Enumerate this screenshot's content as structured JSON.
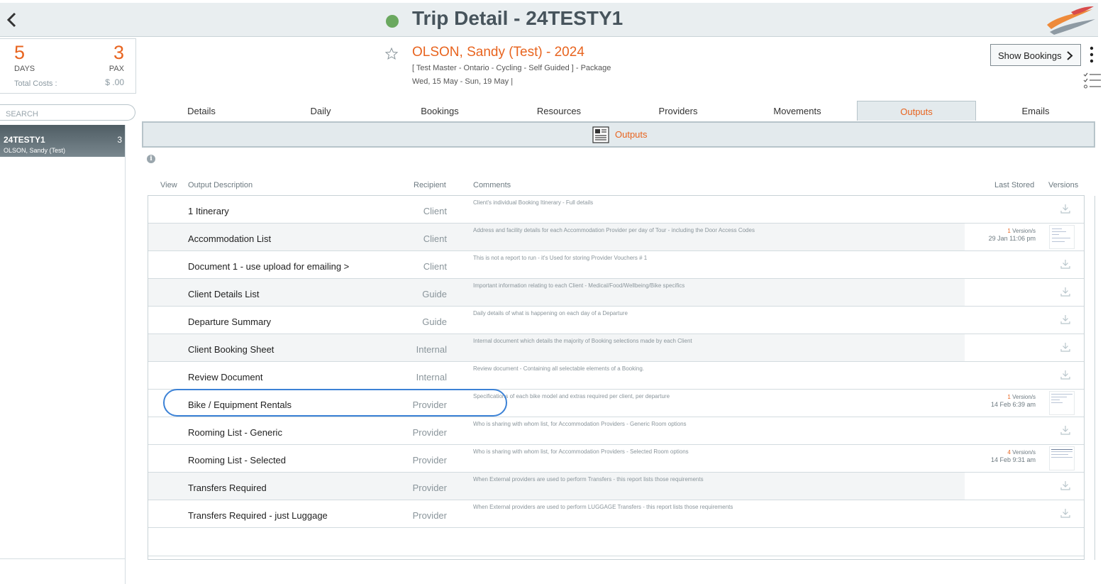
{
  "header": {
    "title": "Trip Detail - 24TESTY1",
    "status_color": "#6aa85f"
  },
  "summary": {
    "days_value": "5",
    "days_label": "DAYS",
    "pax_value": "3",
    "pax_label": "PAX",
    "total_costs_label": "Total Costs :",
    "total_costs_value": "$ .00"
  },
  "search": {
    "placeholder": "SEARCH"
  },
  "trip_list": [
    {
      "code": "24TESTY1",
      "count": "3",
      "name": "OLSON, Sandy (Test)"
    }
  ],
  "booking": {
    "title": "OLSON, Sandy (Test) - 2024",
    "subtitle": "[ Test Master - Ontario - Cycling - Self Guided ] - Package",
    "dates": "Wed, 15 May  - Sun, 19 May  |"
  },
  "actions": {
    "show_bookings": "Show Bookings"
  },
  "tabs": [
    "Details",
    "Daily",
    "Bookings",
    "Resources",
    "Providers",
    "Movements",
    "Outputs",
    "Emails"
  ],
  "active_tab": "Outputs",
  "subbar": {
    "label": "Outputs"
  },
  "table": {
    "headers": {
      "view": "View",
      "description": "Output Description",
      "recipient": "Recipient",
      "comments": "Comments",
      "last_stored": "Last Stored",
      "versions": "Versions"
    },
    "rows": [
      {
        "description": "1 Itinerary",
        "recipient": "Client",
        "comment": "Client's individual Booking Itinerary - Full details",
        "versions": "",
        "version_label": "",
        "stored": ""
      },
      {
        "description": "Accommodation List",
        "recipient": "Client",
        "comment": "Address and facility details for each Accommodation Provider per day of Tour - including the Door Access Codes",
        "versions": "1",
        "version_label": "Version/s",
        "stored": "29 Jan 11:06 pm"
      },
      {
        "description": "Document 1 - use upload for emailing >",
        "recipient": "Client",
        "comment": "This is not a report to run - it's Used for storing Provider Vouchers # 1",
        "versions": "",
        "version_label": "",
        "stored": ""
      },
      {
        "description": "Client Details List",
        "recipient": "Guide",
        "comment": "Important information relating to each Client - Medical/Food/Wellbeing/Bike specifics",
        "versions": "",
        "version_label": "",
        "stored": ""
      },
      {
        "description": "Departure Summary",
        "recipient": "Guide",
        "comment": "Daily details of what is happening on each day of a Departure",
        "versions": "",
        "version_label": "",
        "stored": ""
      },
      {
        "description": "Client Booking Sheet",
        "recipient": "Internal",
        "comment": "Internal document which details the majority of Booking selections made by each Client",
        "versions": "",
        "version_label": "",
        "stored": ""
      },
      {
        "description": "Review Document",
        "recipient": "Internal",
        "comment": "Review document  - Containing all selectable elements of a Booking.",
        "versions": "",
        "version_label": "",
        "stored": ""
      },
      {
        "description": "Bike  / Equipment Rentals",
        "recipient": "Provider",
        "comment": "Specifications of each bike model and extras required per client, per departure",
        "versions": "1",
        "version_label": "Version/s",
        "stored": "14 Feb 6:39 am"
      },
      {
        "description": "Rooming List - Generic",
        "recipient": "Provider",
        "comment": "Who is sharing with whom list, for Accommodation Providers - Generic Room options",
        "versions": "",
        "version_label": "",
        "stored": ""
      },
      {
        "description": "Rooming List - Selected",
        "recipient": "Provider",
        "comment": "Who is sharing with whom list, for Accommodation Providers - Selected Room options",
        "versions": "4",
        "version_label": "Version/s",
        "stored": "14 Feb 9:31 am"
      },
      {
        "description": "Transfers Required",
        "recipient": "Provider",
        "comment": "When External providers are used to perform Transfers - this report lists those requirements",
        "versions": "",
        "version_label": "",
        "stored": ""
      },
      {
        "description": "Transfers Required - just Luggage",
        "recipient": "Provider",
        "comment": "When External providers are used to perform LUGGAGE Transfers - this report lists those requirements",
        "versions": "",
        "version_label": "",
        "stored": ""
      }
    ]
  },
  "colors": {
    "accent": "#e8641f",
    "active_tab_bg": "#e3eaed",
    "highlight": "#3c82d6"
  },
  "icons": [
    "back-chevron-icon",
    "status-dot-icon",
    "brand-logo",
    "star-icon",
    "chevron-right-icon",
    "kebab-icon",
    "checklist-icon",
    "outputs-document-icon",
    "info-icon",
    "download-icon",
    "document-thumbnail"
  ]
}
